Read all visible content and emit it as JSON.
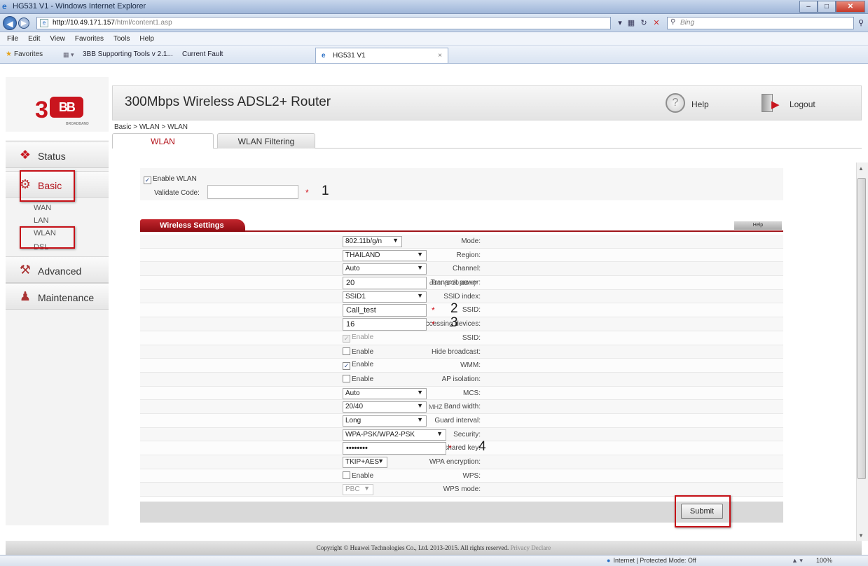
{
  "browser": {
    "window_title": "HG531 V1 - Windows Internet Explorer",
    "url_host": "http://10.49.171.157",
    "url_path": "/html/content1.asp",
    "search_placeholder": "Bing",
    "menu": [
      "File",
      "Edit",
      "View",
      "Favorites",
      "Tools",
      "Help"
    ],
    "favorites_label": "Favorites",
    "fav_links": [
      "3BB Supporting Tools v 2.1...",
      "Current Fault"
    ],
    "tab_title": "HG531 V1",
    "status_zone": "Internet | Protected Mode: Off",
    "zoom": "100%"
  },
  "header": {
    "logo_text": "3BB",
    "logo_sub": "BROADBAND",
    "title": "300Mbps Wireless ADSL2+ Router",
    "help_label": "Help",
    "logout_label": "Logout"
  },
  "breadcrumb": "Basic > WLAN > WLAN",
  "tabs": {
    "wlan": "WLAN",
    "filtering": "WLAN Filtering"
  },
  "sidebar": {
    "status": "Status",
    "basic": "Basic",
    "basic_items": [
      "WAN",
      "LAN",
      "WLAN",
      "DSL"
    ],
    "advanced": "Advanced",
    "maintenance": "Maintenance"
  },
  "enable": {
    "enable_label": "Enable WLAN",
    "enable_checked": true,
    "validate_label": "Validate Code:",
    "validate_value": "",
    "required_mark": "*"
  },
  "wireless_settings": {
    "title": "Wireless Settings",
    "help_label": "Help",
    "mode_label": "Mode:",
    "mode_value": "802.11b/g/n",
    "region_label": "Region:",
    "region_value": "THAILAND",
    "channel_label": "Channel:",
    "channel_value": "Auto",
    "tx_label": "Transmit power:",
    "tx_value": "20",
    "tx_hint": "dBm (1-20 dBm)*",
    "ssid_index_label": "SSID index:",
    "ssid_index_value": "SSID1",
    "ssid_label": "SSID:",
    "ssid_value": "Call_test",
    "max_dev_label": "Maximum number of accessing devices:",
    "max_dev_value": "16",
    "ssid_enable_label": "SSID:",
    "ssid_enable_text": "Enable",
    "hide_label": "Hide broadcast:",
    "hide_text": "Enable",
    "wmm_label": "WMM:",
    "wmm_text": "Enable",
    "ap_iso_label": "AP isolation:",
    "ap_iso_text": "Enable",
    "mcs_label": "MCS:",
    "mcs_value": "Auto",
    "bw_label": "Band width:",
    "bw_value": "20/40",
    "bw_unit": "MHZ",
    "guard_label": "Guard interval:",
    "guard_value": "Long",
    "security_label": "Security:",
    "security_value": "WPA-PSK/WPA2-PSK",
    "psk_label": "WPA pre-shared key:",
    "psk_value": "••••••••",
    "enc_label": "WPA encryption:",
    "enc_value": "TKIP+AES",
    "wps_label": "WPS:",
    "wps_text": "Enable",
    "wps_mode_label": "WPS mode:",
    "wps_mode_value": "PBC",
    "submit_label": "Submit"
  },
  "annotations": [
    "1",
    "2",
    "3",
    "4"
  ],
  "footer": {
    "copyright": "Copyright © Huawei Technologies Co., Ltd. 2013-2015. All rights reserved.",
    "privacy": "Privacy Declare"
  },
  "colors": {
    "accent_red": "#c9151e",
    "header_bg": "#e9e9e9"
  }
}
